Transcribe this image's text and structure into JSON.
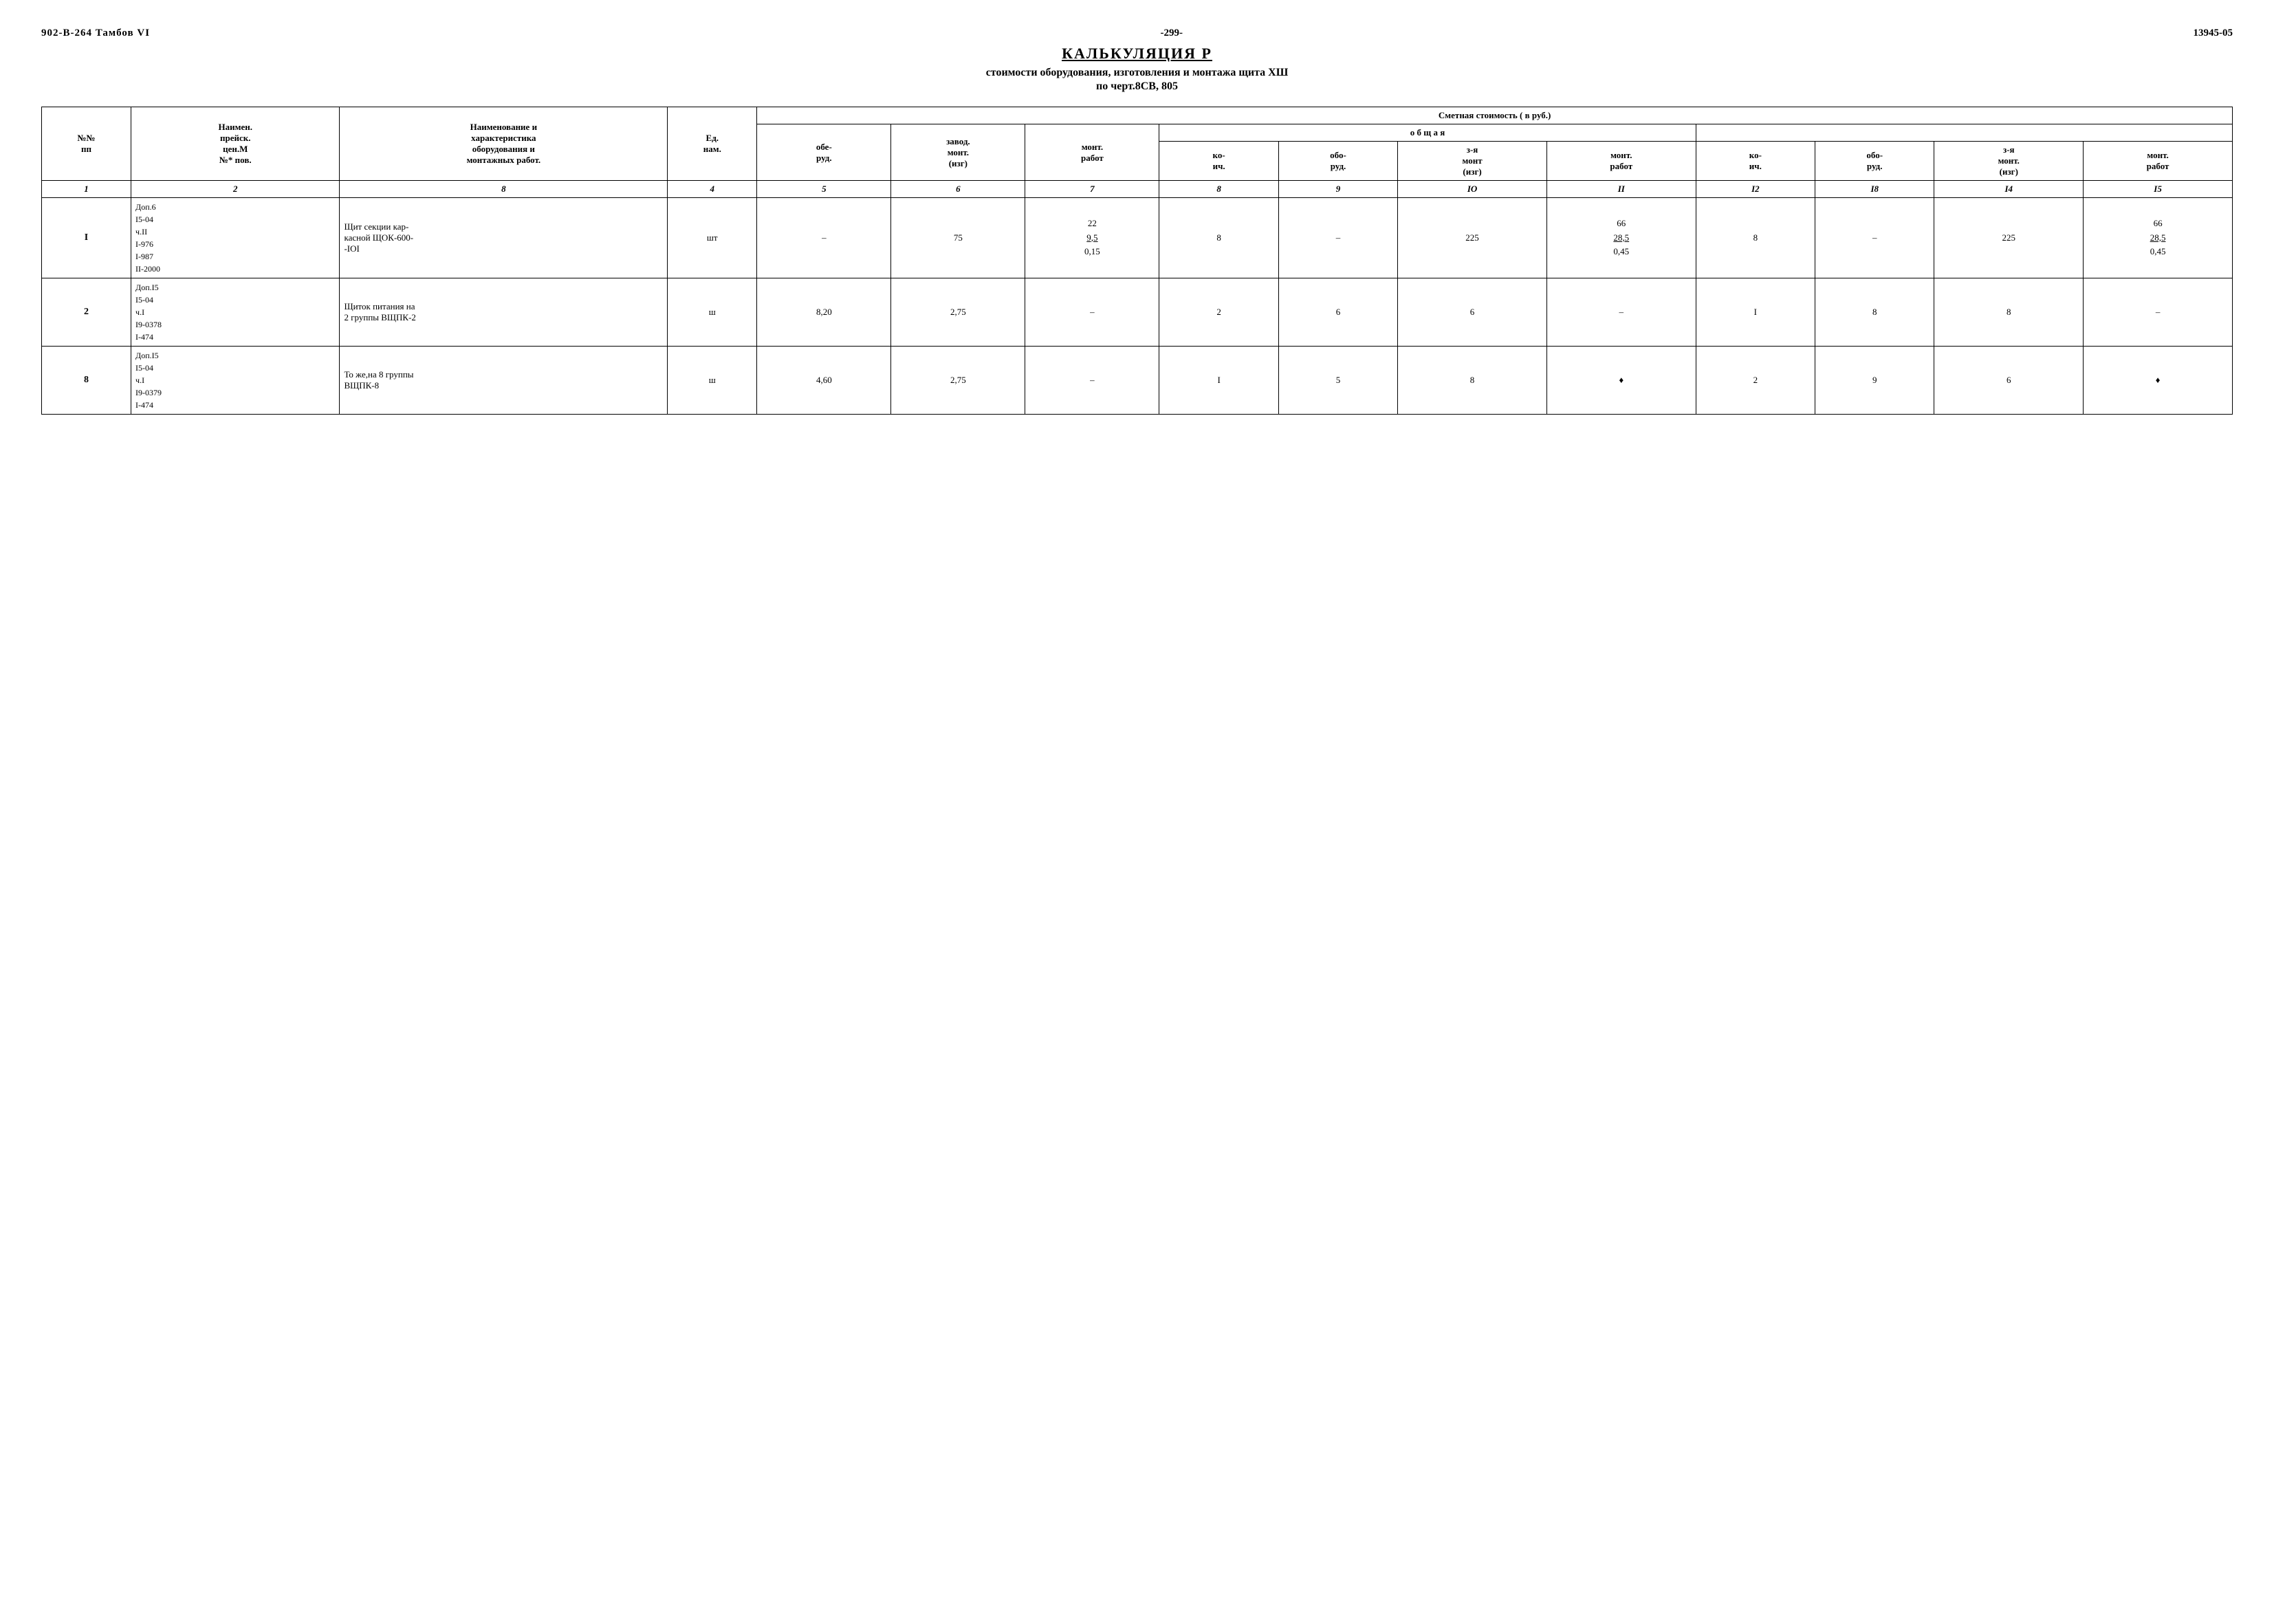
{
  "header": {
    "left": "902-В-264   Тамбов VI",
    "page_num": "-299-",
    "right": "13945-05"
  },
  "title": {
    "main": "КАЛЬКУЛЯЦИЯ  Р",
    "sub1": "стоимости оборудования, изготовления  и монтажа щита ХШ",
    "sub2": "по черт.8СВ, 805"
  },
  "table": {
    "col_headers_row1": [
      "№№ пп",
      "Наимен. прейск. цен.М №* пов.",
      "Наименование и характеристика оборудования и монтажных работ.",
      "Ед. нам.",
      "Сметная стоимость  ( в руб.)",
      "",
      "",
      "",
      "",
      "",
      "",
      "",
      "",
      "",
      ""
    ],
    "smetnaya_sub": [
      "обе- руд.",
      "завод. монт. (изг)",
      "монт. работ",
      "о б щ а я"
    ],
    "obsh_sub": [
      "ко- ич.",
      "обо- руд.",
      "з-я монт (изг)",
      "монт. работ",
      "ко- ич.",
      "обо- руд.",
      "з-я монт. (изг)",
      "монт. работ"
    ],
    "col_nums": [
      "1",
      "2",
      "8",
      "4",
      "5",
      "6",
      "7",
      "8",
      "9",
      "IO",
      "II",
      "I2",
      "I8",
      "I4",
      "I5"
    ],
    "rows": [
      {
        "id": "1",
        "ref": "Доп.6\nI5-04\nч.II\nI-976\nI-987\nII-2000",
        "name": "Щит секции кар-касной ЩОК-600--IOI",
        "unit": "шт",
        "c5": "–",
        "c6": "75",
        "c7": "22\n9,5\n0,15",
        "c8": "8",
        "c9": "–",
        "c10": "225",
        "c11": "66\n28,5\n0,45",
        "c12": "8",
        "c13": "–",
        "c14": "225",
        "c15": "66\n28,5\n0,45"
      },
      {
        "id": "2",
        "ref": "Доп.I5\nI5-04\nч.I\nI9-0378\nI-474",
        "name": "Щиток питания на 2 группы ВЩПК-2",
        "unit": "ш",
        "c5": "8,20",
        "c6": "2,75",
        "c7": "–",
        "c8": "2",
        "c9": "6",
        "c10": "6",
        "c11": "–",
        "c12": "I",
        "c13": "8",
        "c14": "8",
        "c15": "–"
      },
      {
        "id": "8",
        "ref": "Доп.I5\nI5-04\nч.I\nI9-0379\nI-474",
        "name": "То же,на 8 группы ВЩПК-8",
        "unit": "ш",
        "c5": "4,60",
        "c6": "2,75",
        "c7": "–",
        "c8": "I",
        "c9": "5",
        "c10": "8",
        "c11": "♦",
        "c12": "2",
        "c13": "9",
        "c14": "6",
        "c15": "♦"
      }
    ]
  }
}
